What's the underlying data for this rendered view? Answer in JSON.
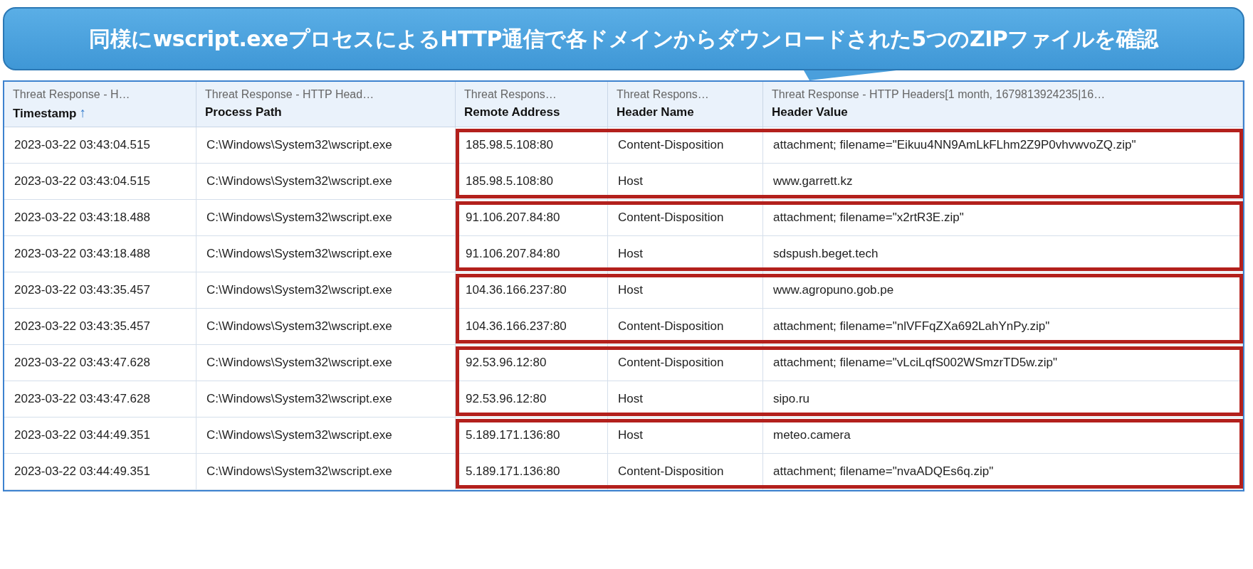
{
  "callout": {
    "text": "同様にwscript.exeプロセスによるHTTP通信で各ドメインからダウンロードされた5つのZIPファイルを確認"
  },
  "table": {
    "columns": [
      {
        "group": "Threat Response - H…",
        "name": "Timestamp",
        "sort_arrow": "↑"
      },
      {
        "group": "Threat Response - HTTP Head…",
        "name": "Process Path"
      },
      {
        "group": "Threat Respons…",
        "name": "Remote Address"
      },
      {
        "group": "Threat Respons…",
        "name": "Header Name"
      },
      {
        "group": "Threat Response - HTTP Headers[1 month, 1679813924235|16…",
        "name": "Header Value"
      }
    ],
    "groups": [
      {
        "highlighted": true,
        "rows": [
          [
            "2023-03-22 03:43:04.515",
            "C:\\Windows\\System32\\wscript.exe",
            "185.98.5.108:80",
            "Content-Disposition",
            "attachment; filename=\"Eikuu4NN9AmLkFLhm2Z9P0vhvwvoZQ.zip\""
          ],
          [
            "2023-03-22 03:43:04.515",
            "C:\\Windows\\System32\\wscript.exe",
            "185.98.5.108:80",
            "Host",
            "www.garrett.kz"
          ]
        ]
      },
      {
        "highlighted": true,
        "rows": [
          [
            "2023-03-22 03:43:18.488",
            "C:\\Windows\\System32\\wscript.exe",
            "91.106.207.84:80",
            "Content-Disposition",
            "attachment; filename=\"x2rtR3E.zip\""
          ],
          [
            "2023-03-22 03:43:18.488",
            "C:\\Windows\\System32\\wscript.exe",
            "91.106.207.84:80",
            "Host",
            "sdspush.beget.tech"
          ]
        ]
      },
      {
        "highlighted": true,
        "rows": [
          [
            "2023-03-22 03:43:35.457",
            "C:\\Windows\\System32\\wscript.exe",
            "104.36.166.237:80",
            "Host",
            "www.agropuno.gob.pe"
          ],
          [
            "2023-03-22 03:43:35.457",
            "C:\\Windows\\System32\\wscript.exe",
            "104.36.166.237:80",
            "Content-Disposition",
            "attachment; filename=\"nlVFFqZXa692LahYnPy.zip\""
          ]
        ]
      },
      {
        "highlighted": true,
        "rows": [
          [
            "2023-03-22 03:43:47.628",
            "C:\\Windows\\System32\\wscript.exe",
            "92.53.96.12:80",
            "Content-Disposition",
            "attachment; filename=\"vLciLqfS002WSmzrTD5w.zip\""
          ],
          [
            "2023-03-22 03:43:47.628",
            "C:\\Windows\\System32\\wscript.exe",
            "92.53.96.12:80",
            "Host",
            "sipo.ru"
          ]
        ]
      },
      {
        "highlighted": true,
        "rows": [
          [
            "2023-03-22 03:44:49.351",
            "C:\\Windows\\System32\\wscript.exe",
            "5.189.171.136:80",
            "Host",
            "meteo.camera"
          ],
          [
            "2023-03-22 03:44:49.351",
            "C:\\Windows\\System32\\wscript.exe",
            "5.189.171.136:80",
            "Content-Disposition",
            "attachment; filename=\"nvaADQEs6q.zip\""
          ]
        ]
      }
    ]
  }
}
